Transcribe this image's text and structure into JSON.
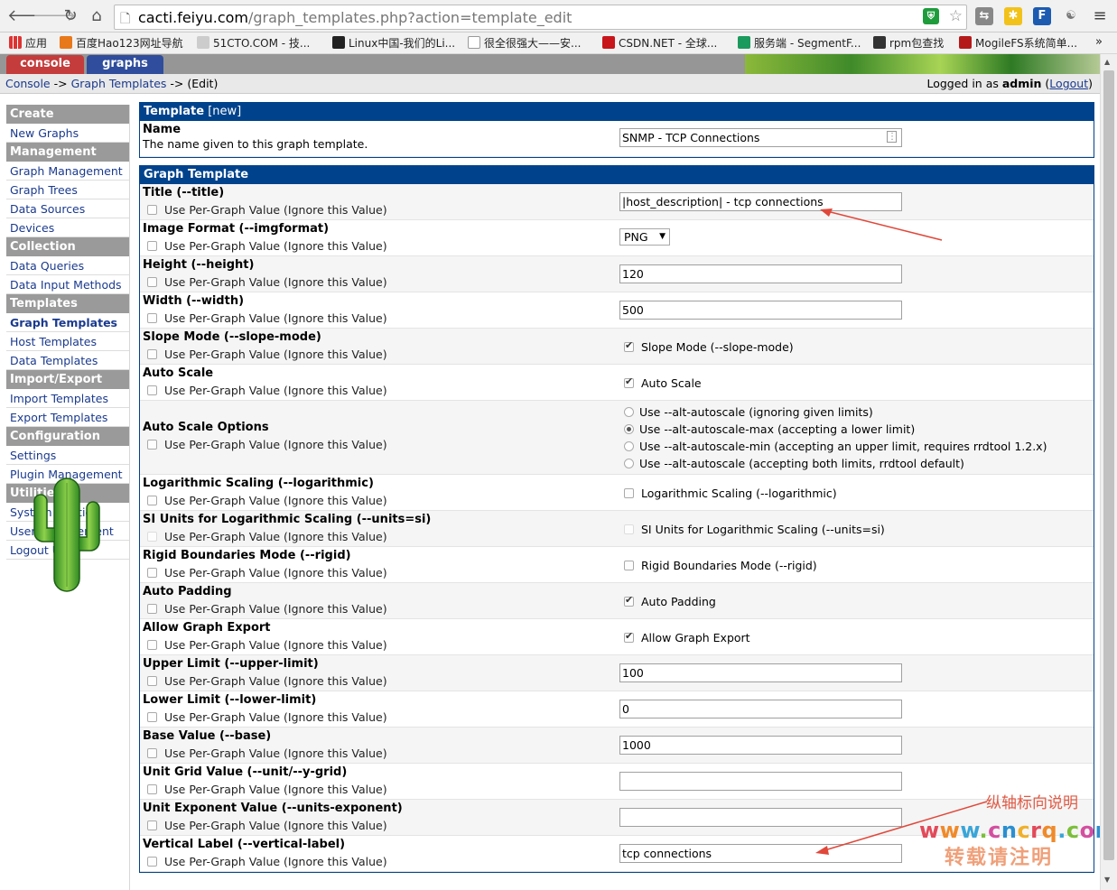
{
  "browser": {
    "url_host": "cacti.feiyu.com",
    "url_path": "/graph_templates.php?action=template_edit",
    "bookmarks": [
      "应用",
      "百度Hao123网址导航",
      "51CTO.COM - 技...",
      "Linux中国-我们的Li...",
      "很全很强大——安...",
      "CSDN.NET - 全球...",
      "服务端 - SegmentF...",
      "rpm包查找",
      "MogileFS系统简单..."
    ]
  },
  "tabs": {
    "console": "console",
    "graphs": "graphs"
  },
  "breadcrumb": {
    "console": "Console",
    "sep1": " -> ",
    "templates": "Graph Templates",
    "sep2": " -> ",
    "edit": "(Edit)"
  },
  "login": {
    "prefix": "Logged in as ",
    "user": "admin",
    "open": " (",
    "logout": "Logout",
    "close": ")"
  },
  "sidebar": [
    {
      "type": "hdr",
      "label": "Create"
    },
    {
      "type": "item",
      "label": "New Graphs"
    },
    {
      "type": "hdr",
      "label": "Management"
    },
    {
      "type": "item",
      "label": "Graph Management"
    },
    {
      "type": "item",
      "label": "Graph Trees"
    },
    {
      "type": "item",
      "label": "Data Sources"
    },
    {
      "type": "item",
      "label": "Devices"
    },
    {
      "type": "hdr",
      "label": "Collection Methods"
    },
    {
      "type": "item",
      "label": "Data Queries"
    },
    {
      "type": "item",
      "label": "Data Input Methods"
    },
    {
      "type": "hdr",
      "label": "Templates"
    },
    {
      "type": "item",
      "label": "Graph Templates",
      "active": true
    },
    {
      "type": "item",
      "label": "Host Templates"
    },
    {
      "type": "item",
      "label": "Data Templates"
    },
    {
      "type": "hdr",
      "label": "Import/Export"
    },
    {
      "type": "item",
      "label": "Import Templates"
    },
    {
      "type": "item",
      "label": "Export Templates"
    },
    {
      "type": "hdr",
      "label": "Configuration"
    },
    {
      "type": "item",
      "label": "Settings"
    },
    {
      "type": "item",
      "label": "Plugin Management"
    },
    {
      "type": "hdr",
      "label": "Utilities"
    },
    {
      "type": "item",
      "label": "System Utilities"
    },
    {
      "type": "item",
      "label": "User Management"
    },
    {
      "type": "item",
      "label": "Logout User"
    }
  ],
  "template_panel": {
    "title": "Template",
    "title_sub": " [new]",
    "name_label": "Name",
    "name_desc": "The name given to this graph template.",
    "name_value": "SNMP - TCP Connections"
  },
  "graph_panel": {
    "title": "Graph Template",
    "per_graph_text": "Use Per-Graph Value (Ignore this Value)",
    "fields": {
      "title": {
        "label": "Title (--title)",
        "value": "|host_description| - tcp connections"
      },
      "imgformat": {
        "label": "Image Format (--imgformat)",
        "value": "PNG"
      },
      "height": {
        "label": "Height (--height)",
        "value": "120"
      },
      "width": {
        "label": "Width (--width)",
        "value": "500"
      },
      "slope": {
        "label": "Slope Mode (--slope-mode)",
        "check_label": "Slope Mode (--slope-mode)",
        "checked": true
      },
      "autoscale": {
        "label": "Auto Scale",
        "check_label": "Auto Scale",
        "checked": true
      },
      "autoscale_opts": {
        "label": "Auto Scale Options",
        "options": [
          "Use --alt-autoscale (ignoring given limits)",
          "Use --alt-autoscale-max (accepting a lower limit)",
          "Use --alt-autoscale-min (accepting an upper limit, requires rrdtool 1.2.x)",
          "Use --alt-autoscale (accepting both limits, rrdtool default)"
        ],
        "selected": 1
      },
      "logarithmic": {
        "label": "Logarithmic Scaling (--logarithmic)",
        "check_label": "Logarithmic Scaling (--logarithmic)",
        "checked": false
      },
      "units_si": {
        "label": "SI Units for Logarithmic Scaling (--units=si)",
        "check_label": "SI Units for Logarithmic Scaling (--units=si)",
        "checked": false
      },
      "rigid": {
        "label": "Rigid Boundaries Mode (--rigid)",
        "check_label": "Rigid Boundaries Mode (--rigid)",
        "checked": false
      },
      "padding": {
        "label": "Auto Padding",
        "check_label": "Auto Padding",
        "checked": true
      },
      "export": {
        "label": "Allow Graph Export",
        "check_label": "Allow Graph Export",
        "checked": true
      },
      "upper": {
        "label": "Upper Limit (--upper-limit)",
        "value": "100"
      },
      "lower": {
        "label": "Lower Limit (--lower-limit)",
        "value": "0"
      },
      "base": {
        "label": "Base Value (--base)",
        "value": "1000"
      },
      "unitgrid": {
        "label": "Unit Grid Value (--unit/--y-grid)",
        "value": ""
      },
      "unitexp": {
        "label": "Unit Exponent Value (--units-exponent)",
        "value": ""
      },
      "vlabel": {
        "label": "Vertical Label (--vertical-label)",
        "value": "tcp connections"
      }
    }
  },
  "annotation": {
    "text": "纵轴标向说明",
    "wm_url": "www.cncrq.com",
    "wm_note": "转载请注明"
  },
  "colors": {
    "header_blue": "#00438c",
    "sidebar_hdr": "#9a9a9a",
    "link": "#1a3a8e",
    "console_tab": "#c43c3c",
    "graphs_tab": "#2f4d9c",
    "annotation": "#e0483a"
  }
}
